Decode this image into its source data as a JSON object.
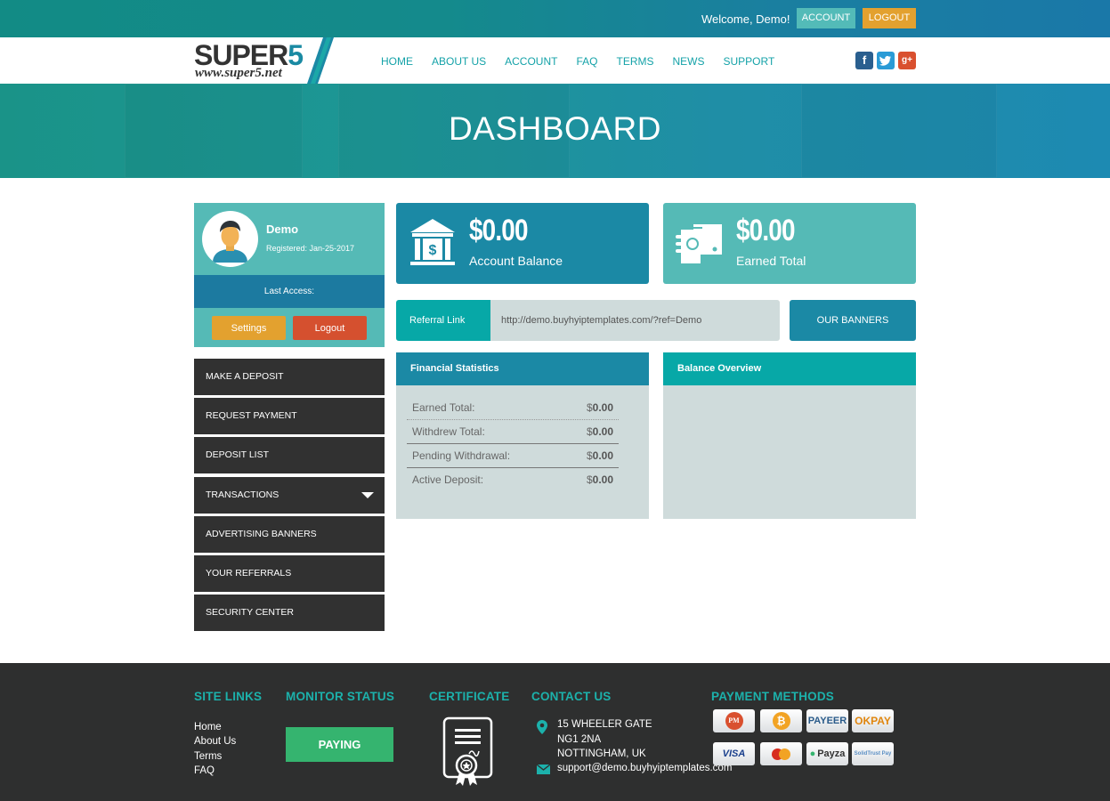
{
  "topbar": {
    "welcome": "Welcome, Demo!",
    "account_label": "ACCOUNT",
    "logout_label": "LOGOUT"
  },
  "brand": {
    "name_main": "SUPER",
    "name_accent": "5",
    "url": "www.super5.net"
  },
  "nav": {
    "items": [
      "HOME",
      "ABOUT US",
      "ACCOUNT",
      "FAQ",
      "TERMS",
      "NEWS",
      "SUPPORT"
    ],
    "social": [
      {
        "name": "facebook",
        "glyph": "f"
      },
      {
        "name": "twitter",
        "glyph": "t"
      },
      {
        "name": "google-plus",
        "glyph": "g+"
      }
    ]
  },
  "hero": {
    "title": "DASHBOARD"
  },
  "profile": {
    "name": "Demo",
    "registered": "Registered: Jan-25-2017",
    "last_access": "Last Access:",
    "settings_label": "Settings",
    "logout_label": "Logout"
  },
  "menu": {
    "items": [
      {
        "label": "MAKE A DEPOSIT"
      },
      {
        "label": "REQUEST PAYMENT"
      },
      {
        "label": "DEPOSIT LIST"
      },
      {
        "label": "TRANSACTIONS",
        "has_dropdown": true
      },
      {
        "label": "ADVERTISING BANNERS"
      },
      {
        "label": "YOUR REFERRALS"
      },
      {
        "label": "SECURITY CENTER"
      }
    ]
  },
  "stats": {
    "balance": {
      "value": "$0.00",
      "label": "Account Balance",
      "icon": "bank-icon"
    },
    "earned": {
      "value": "$0.00",
      "label": "Earned Total",
      "icon": "money-hand-icon"
    }
  },
  "referral": {
    "label": "Referral Link",
    "value": "http://demo.buyhyiptemplates.com/?ref=Demo",
    "banners_label": "OUR BANNERS"
  },
  "financial": {
    "title": "Financial Statistics",
    "rows": [
      {
        "label": "Earned Total:",
        "currency": "$",
        "amount": "0.00"
      },
      {
        "label": "Withdrew Total:",
        "currency": "$",
        "amount": "0.00"
      },
      {
        "label": "Pending Withdrawal:",
        "currency": "$",
        "amount": "0.00"
      },
      {
        "label": "Active Deposit:",
        "currency": "$",
        "amount": "0.00"
      }
    ]
  },
  "balance_overview": {
    "title": "Balance Overview"
  },
  "footer": {
    "site_links": {
      "heading": "SITE LINKS",
      "links": [
        "Home",
        "About Us",
        "Terms",
        "FAQ"
      ]
    },
    "monitor": {
      "heading": "MONITOR STATUS",
      "status": "PAYING"
    },
    "certificate": {
      "heading": "CERTIFICATE"
    },
    "contact": {
      "heading": "CONTACT US",
      "address": [
        "15 WHEELER GATE",
        "NG1 2NA",
        "NOTTINGHAM, UK"
      ],
      "email": "support@demo.buyhyiptemplates.com"
    },
    "payments": {
      "heading": "PAYMENT METHODS",
      "methods": [
        "PM",
        "Bitcoin",
        "PAYEER",
        "OKPAY",
        "VISA",
        "MasterCard",
        "Payza",
        "SolidTrust Pay"
      ]
    }
  },
  "colors": {
    "teal": "#55bab6",
    "blue": "#1b89a5",
    "dark_teal": "#07a8a7",
    "orange": "#e3a12f",
    "red": "#d5502f",
    "menu_dark": "#313131",
    "green": "#35b46f",
    "footer": "#2e2f2f",
    "panel_bg": "#cfdbdb"
  }
}
